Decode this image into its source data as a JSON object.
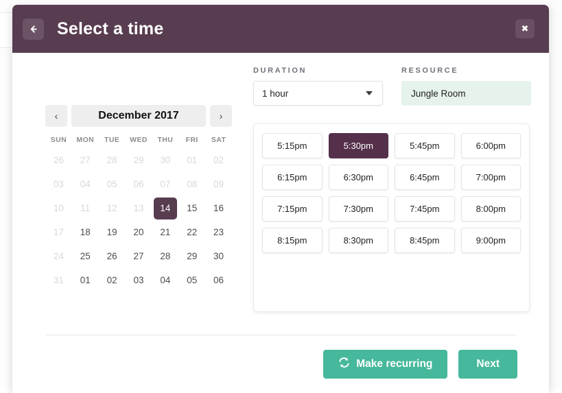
{
  "header": {
    "title": "Select a time",
    "back_icon": "arrow-left-icon",
    "close_label": "✖",
    "background_color": "#583c50"
  },
  "duration": {
    "label": "DURATION",
    "value": "1 hour",
    "caret_icon": "chevron-down-icon"
  },
  "resource": {
    "label": "RESOURCE",
    "value": "Jungle Room",
    "background_color": "#e6f3ec"
  },
  "calendar": {
    "title": "December 2017",
    "prev_label": "‹",
    "next_label": "›",
    "weekdays": [
      "SUN",
      "MON",
      "TUE",
      "WED",
      "THU",
      "FRI",
      "SAT"
    ],
    "selected_day": "14",
    "selected_color": "#583c50",
    "weeks": [
      [
        {
          "label": "26",
          "state": "muted"
        },
        {
          "label": "27",
          "state": "muted"
        },
        {
          "label": "28",
          "state": "muted"
        },
        {
          "label": "29",
          "state": "muted"
        },
        {
          "label": "30",
          "state": "muted"
        },
        {
          "label": "01",
          "state": "muted"
        },
        {
          "label": "02",
          "state": "muted"
        }
      ],
      [
        {
          "label": "03",
          "state": "muted"
        },
        {
          "label": "04",
          "state": "muted"
        },
        {
          "label": "05",
          "state": "muted"
        },
        {
          "label": "06",
          "state": "muted"
        },
        {
          "label": "07",
          "state": "muted"
        },
        {
          "label": "08",
          "state": "muted"
        },
        {
          "label": "09",
          "state": "muted"
        }
      ],
      [
        {
          "label": "10",
          "state": "muted"
        },
        {
          "label": "11",
          "state": "muted"
        },
        {
          "label": "12",
          "state": "muted"
        },
        {
          "label": "13",
          "state": "muted"
        },
        {
          "label": "14",
          "state": "selected"
        },
        {
          "label": "15",
          "state": "active"
        },
        {
          "label": "16",
          "state": "active"
        }
      ],
      [
        {
          "label": "17",
          "state": "muted"
        },
        {
          "label": "18",
          "state": "active"
        },
        {
          "label": "19",
          "state": "active"
        },
        {
          "label": "20",
          "state": "active"
        },
        {
          "label": "21",
          "state": "active"
        },
        {
          "label": "22",
          "state": "active"
        },
        {
          "label": "23",
          "state": "active"
        }
      ],
      [
        {
          "label": "24",
          "state": "muted"
        },
        {
          "label": "25",
          "state": "active"
        },
        {
          "label": "26",
          "state": "active"
        },
        {
          "label": "27",
          "state": "active"
        },
        {
          "label": "28",
          "state": "active"
        },
        {
          "label": "29",
          "state": "active"
        },
        {
          "label": "30",
          "state": "active"
        }
      ],
      [
        {
          "label": "31",
          "state": "muted"
        },
        {
          "label": "01",
          "state": "active"
        },
        {
          "label": "02",
          "state": "active"
        },
        {
          "label": "03",
          "state": "active"
        },
        {
          "label": "04",
          "state": "active"
        },
        {
          "label": "05",
          "state": "active"
        },
        {
          "label": "06",
          "state": "active"
        }
      ]
    ]
  },
  "slots": {
    "selected": "5:30pm",
    "selected_color": "#54304a",
    "items": [
      {
        "label": "5:15pm",
        "state": "available"
      },
      {
        "label": "5:30pm",
        "state": "selected"
      },
      {
        "label": "5:45pm",
        "state": "available"
      },
      {
        "label": "6:00pm",
        "state": "available"
      },
      {
        "label": "6:15pm",
        "state": "available"
      },
      {
        "label": "6:30pm",
        "state": "available"
      },
      {
        "label": "6:45pm",
        "state": "available"
      },
      {
        "label": "7:00pm",
        "state": "available"
      },
      {
        "label": "7:15pm",
        "state": "available"
      },
      {
        "label": "7:30pm",
        "state": "available"
      },
      {
        "label": "7:45pm",
        "state": "available"
      },
      {
        "label": "8:00pm",
        "state": "available"
      },
      {
        "label": "8:15pm",
        "state": "available"
      },
      {
        "label": "8:30pm",
        "state": "available"
      },
      {
        "label": "8:45pm",
        "state": "available"
      },
      {
        "label": "9:00pm",
        "state": "available"
      }
    ]
  },
  "footer": {
    "make_recurring_label": "Make recurring",
    "recurring_icon": "refresh-cycle-icon",
    "next_label": "Next",
    "button_color": "#46b89b"
  }
}
